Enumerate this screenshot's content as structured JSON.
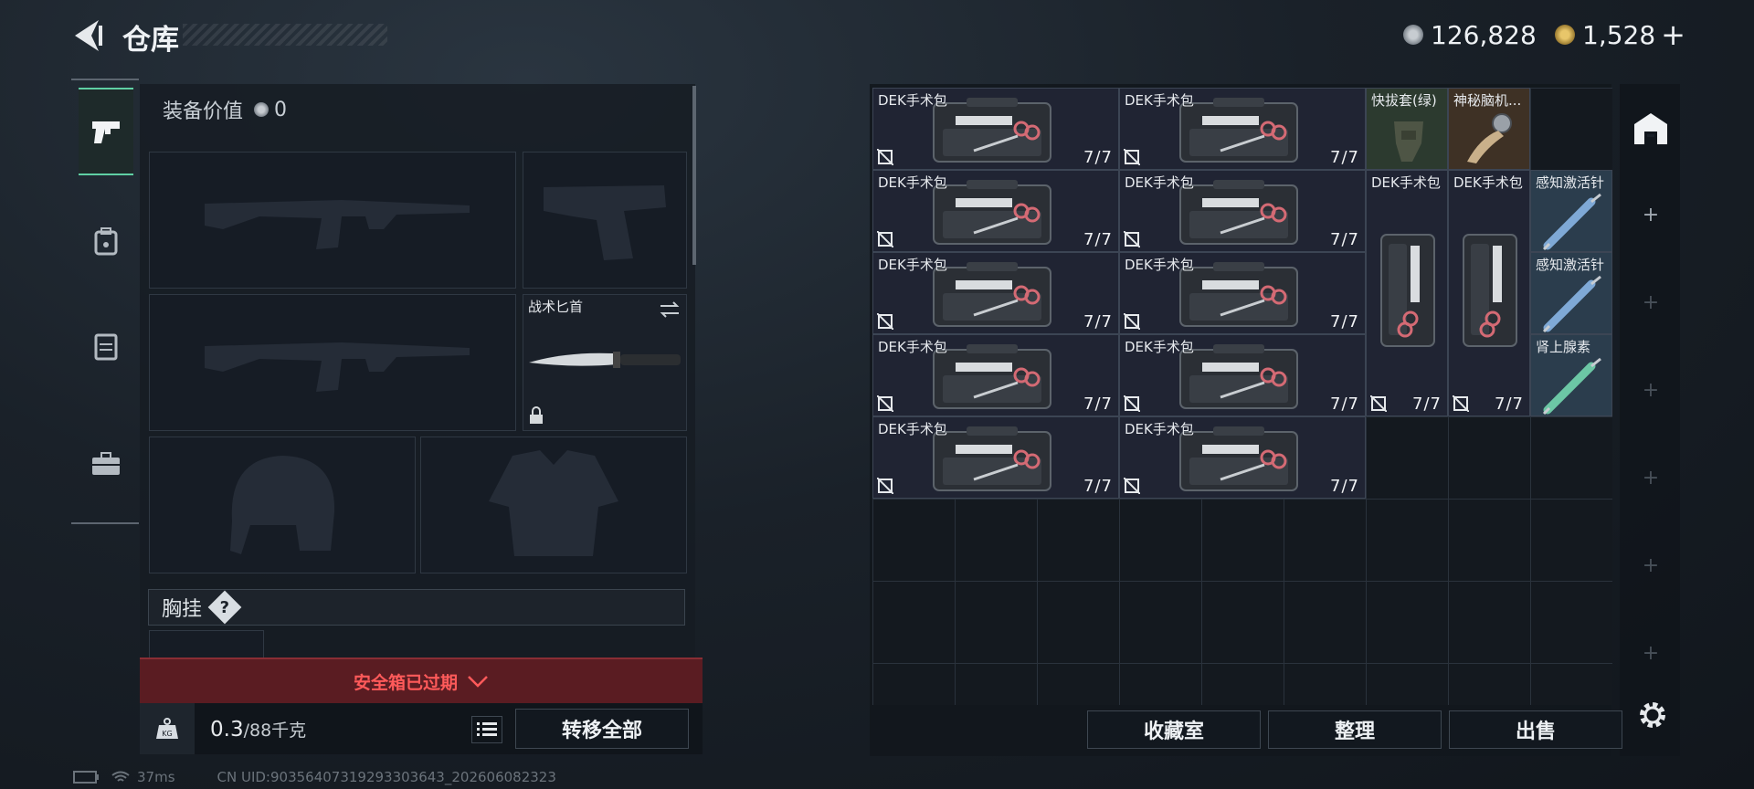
{
  "header": {
    "title": "仓库",
    "currency_silver": "126,828",
    "currency_gold": "1,528",
    "add_label": "+"
  },
  "left": {
    "equip_value_label": "装备价值",
    "equip_value": "0",
    "knife_label": "战术匕首",
    "vest_label": "胸挂",
    "vest_help": "?",
    "safe_box_expired": "安全箱已过期",
    "weight_value": "0.3",
    "weight_max": "/88千克",
    "transfer_all": "转移全部"
  },
  "stash": {
    "items": [
      {
        "name": "DEK手术包",
        "count": "7/7"
      },
      {
        "name": "DEK手术包",
        "count": "7/7"
      },
      {
        "name": "快拔套(绿)",
        "count": ""
      },
      {
        "name": "神秘脑机...",
        "count": ""
      },
      {
        "name": "DEK手术包",
        "count": "7/7"
      },
      {
        "name": "DEK手术包",
        "count": "7/7"
      },
      {
        "name": "DEK手术包",
        "count": "7/7"
      },
      {
        "name": "DEK手术包",
        "count": "7/7"
      },
      {
        "name": "感知激活针",
        "count": ""
      },
      {
        "name": "DEK手术包",
        "count": "7/7"
      },
      {
        "name": "DEK手术包",
        "count": "7/7"
      },
      {
        "name": "感知激活针",
        "count": ""
      },
      {
        "name": "DEK手术包",
        "count": "7/7"
      },
      {
        "name": "DEK手术包",
        "count": "7/7"
      },
      {
        "name": "肾上腺素",
        "count": ""
      },
      {
        "name": "DEK手术包",
        "count": "7/7"
      },
      {
        "name": "DEK手术包",
        "count": "7/7"
      }
    ],
    "collection_btn": "收藏室",
    "sort_btn": "整理",
    "sell_btn": "出售"
  },
  "status_bar": {
    "ping": "37ms",
    "uid": "CN UID:90356407319293303643_202606082323"
  },
  "colors": {
    "accent": "#5fd0a4",
    "danger": "#ff5a5a"
  }
}
